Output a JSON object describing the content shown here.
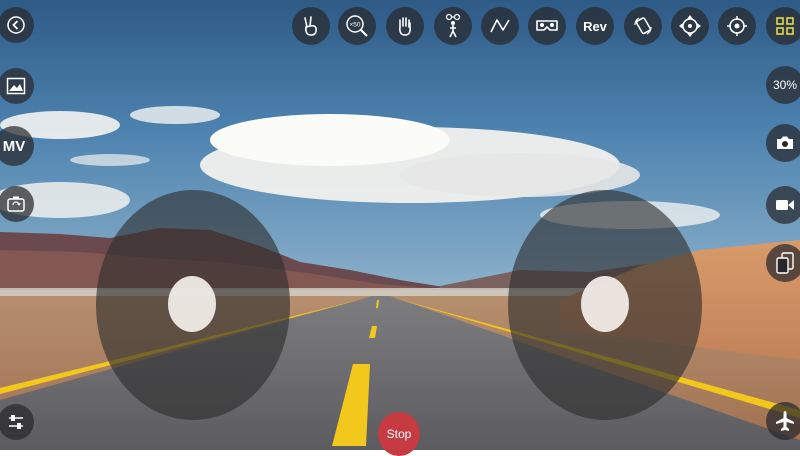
{
  "top_bar": {
    "back": {
      "icon": "back-arrow-icon"
    },
    "gesture": {
      "icon": "peace-gesture-icon"
    },
    "zoom": {
      "icon": "zoom-icon",
      "label": "×50"
    },
    "hand": {
      "icon": "hand-gesture-icon"
    },
    "follow": {
      "icon": "follow-me-icon"
    },
    "trajectory": {
      "icon": "trajectory-icon"
    },
    "vr": {
      "icon": "vr-headset-icon"
    },
    "rev": {
      "label": "Rev"
    },
    "rotate": {
      "icon": "rotate-phone-icon"
    },
    "headless": {
      "icon": "headless-mode-icon"
    },
    "gyro": {
      "icon": "gyro-calibrate-icon"
    },
    "menu": {
      "icon": "grid-menu-icon",
      "color": "#e3d84a"
    }
  },
  "left_bar": {
    "gallery": {
      "icon": "gallery-icon"
    },
    "mv": {
      "label": "MV"
    },
    "camera_switch": {
      "icon": "camera-switch-icon"
    },
    "settings": {
      "icon": "trim-adjust-icon"
    }
  },
  "right_bar": {
    "speed": {
      "label": "30%"
    },
    "photo": {
      "icon": "camera-icon"
    },
    "video": {
      "icon": "video-camera-icon"
    },
    "split": {
      "icon": "split-screen-icon"
    },
    "takeoff": {
      "icon": "airplane-icon"
    }
  },
  "bottom": {
    "stop_label": "Stop",
    "stop_color": "#c63a42"
  },
  "joysticks": {
    "left": {
      "knob_x": 0.5,
      "knob_y": 0.5
    },
    "right": {
      "knob_x": 0.5,
      "knob_y": 0.5
    }
  },
  "colors": {
    "button_bg": "#28282c",
    "sky": "#3d6e9c",
    "road_line": "#f2c81c"
  }
}
